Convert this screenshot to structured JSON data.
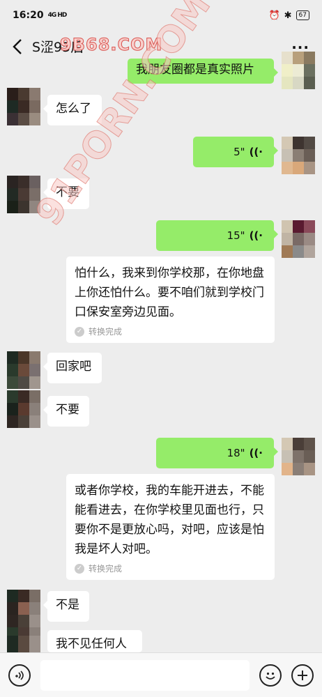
{
  "status": {
    "time": "16:20",
    "signal": "4G HD",
    "battery": "67"
  },
  "header": {
    "title": "S涩95后",
    "watermark": "9B68.COM"
  },
  "watermark_diag": "91PORN.COM",
  "messages": {
    "m1": "我朋友圈都是真实照片",
    "m2": "怎么了",
    "m3": "5\"",
    "m4": "不要",
    "m5": "15\"",
    "t1": "怕什么，我来到你学校那，在你地盘上你还怕什么。要不咱们就到学校门口保安室旁边见面。",
    "m6": "回家吧",
    "m7": "不要",
    "m8": "18\"",
    "t2": "或者你学校，我的车能开进去，不能能看进去，在你学校里见面也行，只要你不是更放心吗，对吧，应该是怕我是坏人对吧。",
    "m9": "不是",
    "m10": "我不见任何人"
  },
  "transcript_status": "转换完成",
  "icons": {
    "back": "back-arrow-icon",
    "more": "more-icon",
    "voice_mode": "voice-mode-icon",
    "emoji": "emoji-icon",
    "plus": "plus-icon"
  },
  "colors": {
    "bg": "#ededed",
    "out_bubble": "#95ec69",
    "in_bubble": "#ffffff"
  }
}
